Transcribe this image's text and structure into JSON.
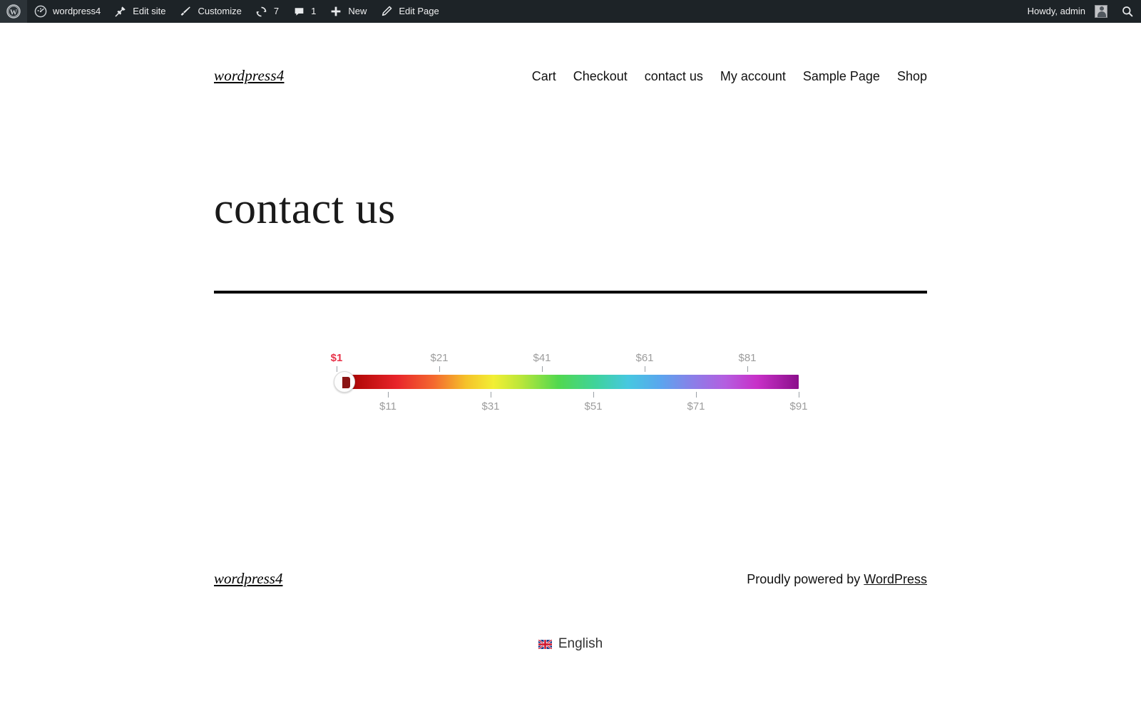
{
  "adminbar": {
    "items": [
      {
        "name": "wp-logo",
        "icon": "wordpress-icon",
        "label": ""
      },
      {
        "name": "site-name",
        "icon": "dashboard-icon",
        "label": "wordpress4"
      },
      {
        "name": "edit-site",
        "icon": "pin-icon",
        "label": "Edit site"
      },
      {
        "name": "customize",
        "icon": "paintbrush-icon",
        "label": "Customize"
      },
      {
        "name": "updates",
        "icon": "update-icon",
        "label": "7"
      },
      {
        "name": "comments",
        "icon": "comment-bubble-icon",
        "label": "1"
      },
      {
        "name": "new-content",
        "icon": "plus-icon",
        "label": "New"
      },
      {
        "name": "edit-page",
        "icon": "pencil-icon",
        "label": "Edit Page"
      }
    ],
    "howdy": "Howdy, admin",
    "search_icon": "search-icon",
    "bg_color": "#1d2327",
    "text_color": "#f0f0f1"
  },
  "header": {
    "site_title": "wordpress4",
    "nav": [
      {
        "label": "Cart"
      },
      {
        "label": "Checkout"
      },
      {
        "label": "contact us"
      },
      {
        "label": "My account"
      },
      {
        "label": "Sample Page"
      },
      {
        "label": "Shop"
      }
    ]
  },
  "main": {
    "page_title": "contact us"
  },
  "price_slider": {
    "name": "price-range-slider",
    "currency": "$",
    "min": 1,
    "max": 91,
    "current_value": "$1",
    "current_value_color": "#e8334a",
    "ticks_top": [
      "$1",
      "$21",
      "$41",
      "$61",
      "$81"
    ],
    "ticks_bottom": [
      "$11",
      "$31",
      "$51",
      "$71",
      "$91"
    ],
    "tick_values_top": [
      1,
      21,
      41,
      61,
      81
    ],
    "tick_values_bottom": [
      11,
      31,
      51,
      71,
      91
    ],
    "handle_position_percent": 0,
    "tick_label_color": "#9c9c9c"
  },
  "footer": {
    "site_title": "wordpress4",
    "credit_prefix": "Proudly powered by ",
    "credit_link": "WordPress",
    "language": {
      "flag": "uk-flag-icon",
      "label": "English"
    }
  }
}
